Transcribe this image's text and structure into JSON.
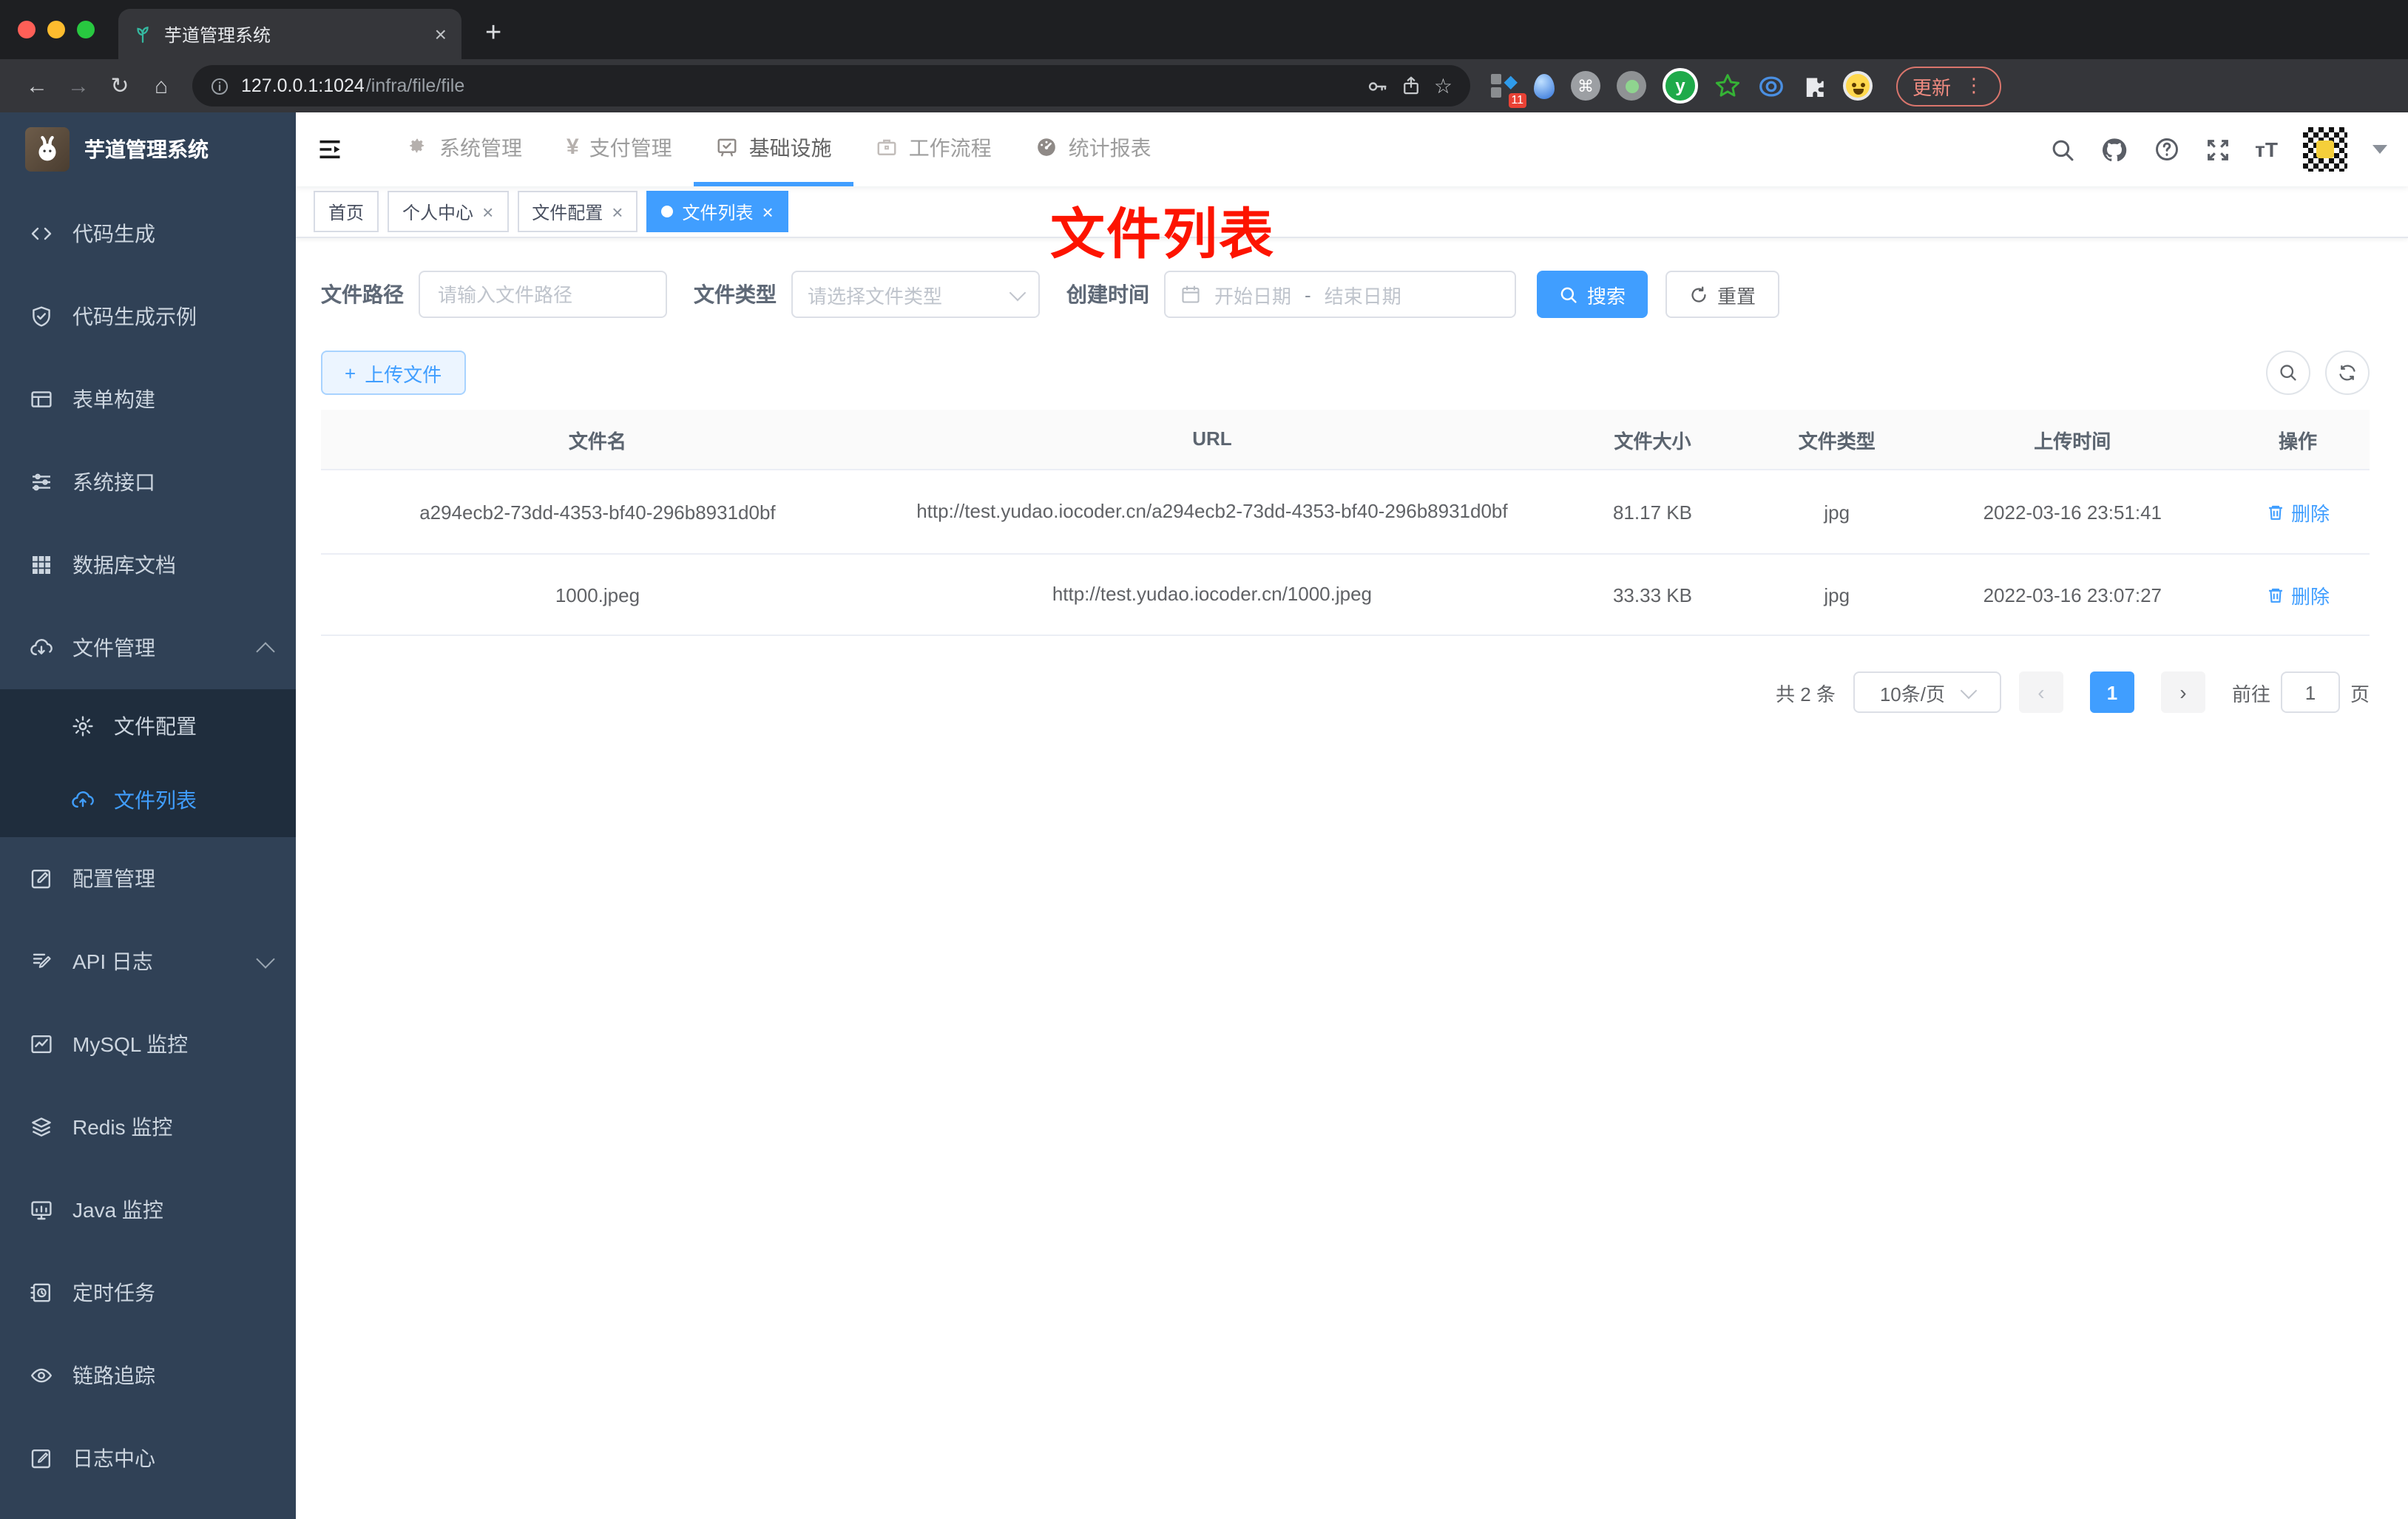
{
  "glyphs": {
    "close": "×",
    "plus": "+",
    "back": "←",
    "forward": "→",
    "reload": "↻",
    "home": "⌂",
    "star": "☆",
    "prev": "‹",
    "next": "›",
    "dots": "⋮",
    "yen": "¥",
    "cmd": "⌘",
    "diamond": "◆",
    "dash": "-",
    "code": "</>",
    "y": "y",
    "upload_plus": "+",
    "tT": "тT"
  },
  "colors": {
    "accent": "#409eff",
    "sidebar_bg": "#304156",
    "submenu_bg": "#1f2d3d",
    "active_tag": "#409eff",
    "update_red": "#f08b80",
    "annotation_red": "#fd1400",
    "upload_bg": "#ecf5ff"
  },
  "browser": {
    "tab_title": "芋道管理系统",
    "url_host": "127.0.0.1:1024",
    "url_path": "/infra/file/file",
    "ext_badge": "11",
    "update_label": "更新"
  },
  "sidebar": {
    "logo_title": "芋道管理系统",
    "items": [
      {
        "icon": "code-icon",
        "label": "代码生成"
      },
      {
        "icon": "shield-check-icon",
        "label": "代码生成示例"
      },
      {
        "icon": "table-icon",
        "label": "表单构建"
      },
      {
        "icon": "sliders-icon",
        "label": "系统接口"
      },
      {
        "icon": "grid-icon",
        "label": "数据库文档"
      },
      {
        "icon": "cloud-download-icon",
        "label": "文件管理"
      },
      {
        "icon": "edit-square-icon",
        "label": "配置管理"
      },
      {
        "icon": "doc-edit-icon",
        "label": "API 日志"
      },
      {
        "icon": "chart-line-icon",
        "label": "MySQL 监控"
      },
      {
        "icon": "layers-icon",
        "label": "Redis 监控"
      },
      {
        "icon": "monitor-icon",
        "label": "Java 监控"
      },
      {
        "icon": "clock-task-icon",
        "label": "定时任务"
      },
      {
        "icon": "eye-icon",
        "label": "链路追踪"
      },
      {
        "icon": "log-edit-icon",
        "label": "日志中心"
      }
    ],
    "submenu": [
      {
        "icon": "gear-icon",
        "label": "文件配置"
      },
      {
        "icon": "cloud-upload-icon",
        "label": "文件列表",
        "active": true
      }
    ]
  },
  "topnav": {
    "items": [
      {
        "icon": "gear-icon",
        "label": "系统管理"
      },
      {
        "icon": "yen-icon",
        "label": "支付管理"
      },
      {
        "icon": "monitor-check-icon",
        "label": "基础设施",
        "active": true
      },
      {
        "icon": "briefcase-icon",
        "label": "工作流程"
      },
      {
        "icon": "gauge-icon",
        "label": "统计报表"
      }
    ]
  },
  "tags": [
    {
      "label": "首页",
      "closable": false
    },
    {
      "label": "个人中心",
      "closable": true
    },
    {
      "label": "文件配置",
      "closable": true
    },
    {
      "label": "文件列表",
      "closable": true,
      "active": true
    }
  ],
  "annotation": {
    "text": "文件列表"
  },
  "filter": {
    "path_label": "文件路径",
    "path_placeholder": "请输入文件路径",
    "type_label": "文件类型",
    "type_placeholder": "请选择文件类型",
    "date_label": "创建时间",
    "date_start": "开始日期",
    "date_sep": "-",
    "date_end": "结束日期",
    "search_label": "搜索",
    "reset_label": "重置"
  },
  "actions": {
    "upload_label": "上传文件"
  },
  "table": {
    "headers": [
      "文件名",
      "URL",
      "文件大小",
      "文件类型",
      "上传时间",
      "操作"
    ],
    "rows": [
      {
        "name": "a294ecb2-73dd-4353-bf40-296b8931d0bf",
        "url": "http://test.yudao.iocoder.cn/a294ecb2-73dd-4353-bf40-296b8931d0bf",
        "size": "81.17 KB",
        "type": "jpg",
        "time": "2022-03-16 23:51:41",
        "action": "删除"
      },
      {
        "name": "1000.jpeg",
        "url": "http://test.yudao.iocoder.cn/1000.jpeg",
        "size": "33.33 KB",
        "type": "jpg",
        "time": "2022-03-16 23:07:27",
        "action": "删除"
      }
    ]
  },
  "pagination": {
    "total_label": "共 2 条",
    "page_size": "10条/页",
    "current": "1",
    "goto_label": "前往",
    "goto_value": "1",
    "page_unit": "页"
  }
}
